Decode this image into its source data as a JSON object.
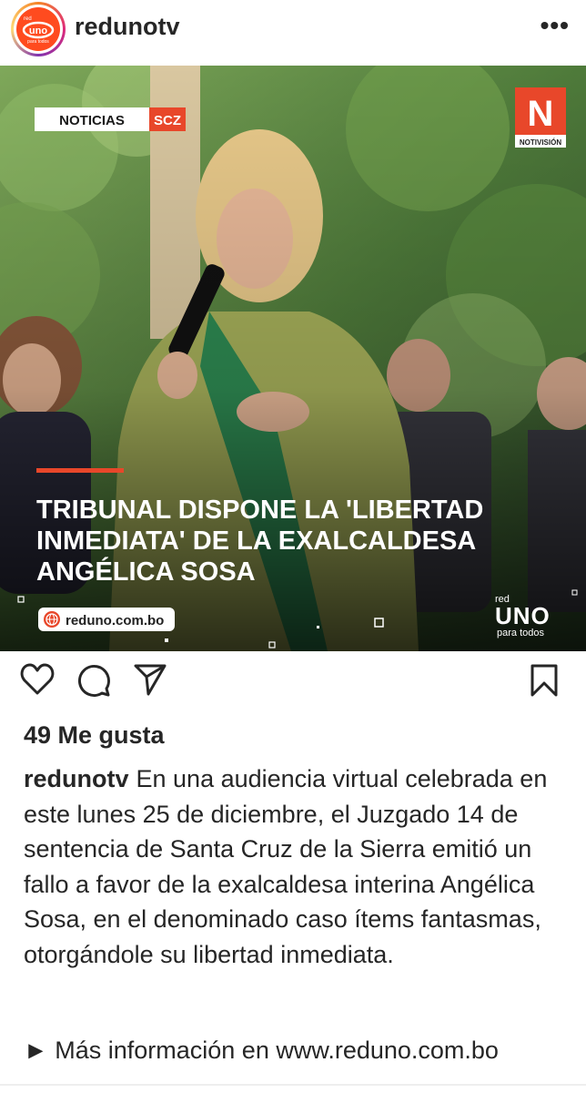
{
  "profile": {
    "username": "redunotv",
    "avatar_text": "uno",
    "avatar_sub": "para todos",
    "avatar_small": "red"
  },
  "header": {
    "more": "•••"
  },
  "post_image": {
    "section_label": "NOTICIAS",
    "region_tag": "SCZ",
    "logo_letter": "N",
    "logo_text": "NOTIVISIÓN",
    "headline_line1": "TRIBUNAL DISPONE LA 'LIBERTAD",
    "headline_line2": "INMEDIATA' DE LA EXALCALDESA",
    "headline_line3": "ANGÉLICA SOSA",
    "site": "reduno.com.bo",
    "brand_small": "red",
    "brand_main": "UNO",
    "brand_tag": "para todos",
    "accent": "#e8472a"
  },
  "actions": {
    "like": "heart-icon",
    "comment": "comment-icon",
    "share": "send-icon",
    "save": "bookmark-icon"
  },
  "likes": "49 Me gusta",
  "caption": {
    "user": "redunotv",
    "text": "En una audiencia virtual celebrada en este lunes 25 de diciembre, el Juzgado 14 de sentencia de Santa Cruz de la Sierra emitió un fallo a favor de la exalcaldesa interina Angélica Sosa, en el denominado caso ítems fantasmas, otorgándole su libertad inmediata."
  },
  "more_info": "► Más información en www.reduno.com.bo"
}
